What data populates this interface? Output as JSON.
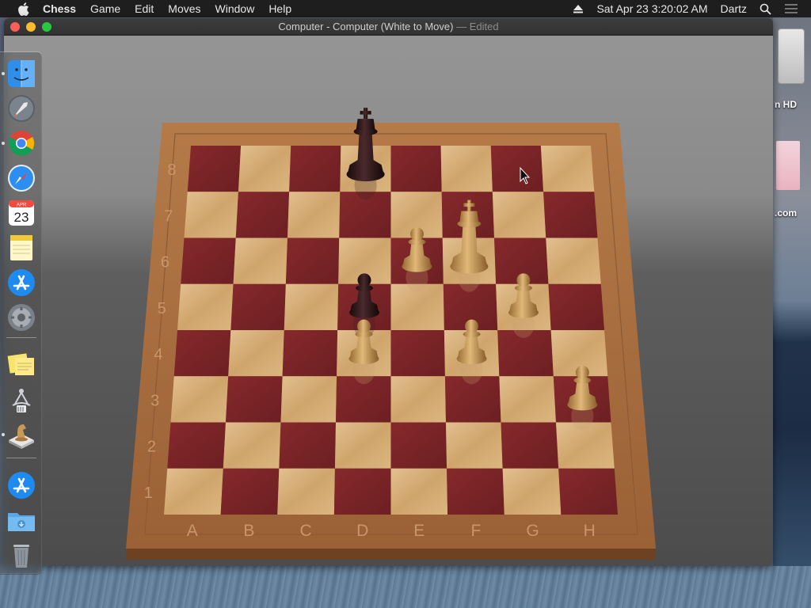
{
  "menubar": {
    "app_name": "Chess",
    "items": [
      "Game",
      "Edit",
      "Moves",
      "Window",
      "Help"
    ],
    "datetime": "Sat Apr 23  3:20:02 AM",
    "user": "Dartz"
  },
  "window": {
    "title": "Computer - Computer   (White to Move)",
    "edited": " — Edited"
  },
  "board": {
    "files": [
      "A",
      "B",
      "C",
      "D",
      "E",
      "F",
      "G",
      "H"
    ],
    "ranks": [
      "1",
      "2",
      "3",
      "4",
      "5",
      "6",
      "7",
      "8"
    ],
    "pieces": [
      {
        "type": "king",
        "color": "black",
        "square": "d8"
      },
      {
        "type": "pawn",
        "color": "black",
        "square": "d5"
      },
      {
        "type": "king",
        "color": "white",
        "square": "f6"
      },
      {
        "type": "pawn",
        "color": "white",
        "square": "e6"
      },
      {
        "type": "pawn",
        "color": "white",
        "square": "g5"
      },
      {
        "type": "pawn",
        "color": "white",
        "square": "d4"
      },
      {
        "type": "pawn",
        "color": "white",
        "square": "f4"
      },
      {
        "type": "pawn",
        "color": "white",
        "square": "h3"
      }
    ]
  },
  "desktop": {
    "hd_label": "n HD",
    "file_label": ".com"
  },
  "dock": {
    "items": [
      {
        "name": "finder",
        "running": true
      },
      {
        "name": "launchpad",
        "running": false
      },
      {
        "name": "chrome",
        "running": true
      },
      {
        "name": "safari",
        "running": false
      },
      {
        "name": "calendar",
        "running": false,
        "month": "APR",
        "day": "23"
      },
      {
        "name": "notes",
        "running": false
      },
      {
        "name": "app-store",
        "running": false
      },
      {
        "name": "system-preferences",
        "running": false
      },
      {
        "name": "stickies",
        "running": false
      },
      {
        "name": "directory-utility",
        "running": false
      },
      {
        "name": "chess",
        "running": true
      },
      {
        "name": "app-store-2",
        "running": false
      },
      {
        "name": "downloads-folder",
        "running": false
      },
      {
        "name": "trash",
        "running": false
      }
    ]
  },
  "colors": {
    "light_square": "#d9b37f",
    "dark_square": "#7a2427",
    "board_frame": "#a36a3e",
    "white_piece": "#c79a5d",
    "black_piece": "#2b1416"
  }
}
